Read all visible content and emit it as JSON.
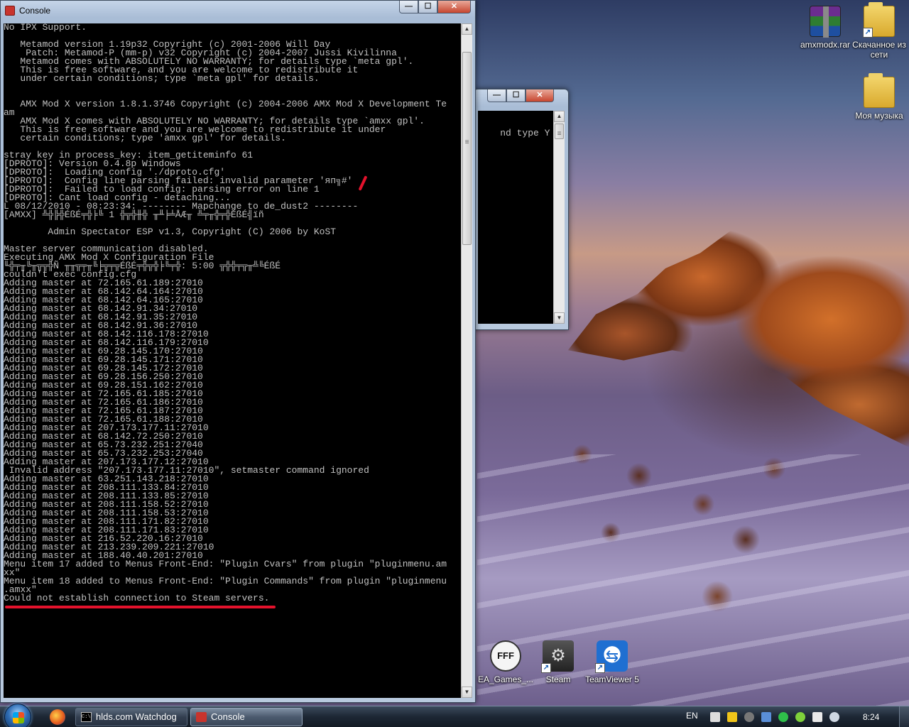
{
  "desktop": {
    "icons": [
      {
        "label": "amxmodx.rar",
        "icon": "winrar-archive-icon"
      },
      {
        "label": "Скачанное из сети",
        "icon": "folder-icon"
      },
      {
        "label": "Моя музыка",
        "icon": "folder-icon"
      },
      {
        "label": "EA_Games_...",
        "icon": "ea-games-icon"
      },
      {
        "label": "Steam",
        "icon": "steam-icon"
      },
      {
        "label": "TeamViewer 5",
        "icon": "teamviewer-icon"
      }
    ]
  },
  "console_window": {
    "title": "Console",
    "lines": [
      "No IPX Support.",
      "",
      "   Metamod version 1.19p32 Copyright (c) 2001-2006 Will Day",
      "    Patch: Metamod-P (mm-p) v32 Copyright (c) 2004-2007 Jussi Kivilinna",
      "   Metamod comes with ABSOLUTELY NO WARRANTY; for details type `meta gpl'.",
      "   This is free software, and you are welcome to redistribute it",
      "   under certain conditions; type `meta gpl' for details.",
      "",
      "",
      "   AMX Mod X version 1.8.1.3746 Copyright (c) 2004-2006 AMX Mod X Development Te",
      "am",
      "   AMX Mod X comes with ABSOLUTELY NO WARRANTY; for details type `amxx gpl'.",
      "   This is free software and you are welcome to redistribute it under",
      "   certain conditions; type 'amxx gpl' for details.",
      "",
      "stray key in process_key: item_getiteminfo 61",
      "[DPROTO]: Version 0.4.8p Windows",
      "[DPROTO]:  Loading config './dproto.cfg'",
      "[DPROTO]:  Config line parsing failed: invalid parameter 'яп╗#'",
      "[DPROTO]:  Failed to load config: parsing error on line 1",
      "[DPROTO]: Cant load config - detaching...",
      "L 08/12/2010 - 08:23:34: -------- Mapchange to de_dust2 --------",
      "[AMXX] ╩╬╠╬ÉßÉ╤╬╞╚ 1 ╬╦╬╫╬ ╥╨╞╧ÅÆ╥ ╩╤╥╬╤╬ÉßÉ╣ïñ",
      "",
      "        Admin Spectator ESP v1.3, Copyright (C) 2006 by KoST",
      "",
      "Master server communication disabled.",
      "Executing AMX Mod X Configuration File",
      "╙╬╤╥╚╥╦╦╬Ñ ╥╥╦╤╥╚╞╦╤╦ÉßÉ╤╬╦╬╞╚╤╬: 5:00 ╦╬╬╤╦╥╩╚ÉßÉ",
      "couldn't exec config.cfg",
      "Adding master at 72.165.61.189:27010",
      "Adding master at 68.142.64.164:27010",
      "Adding master at 68.142.64.165:27010",
      "Adding master at 68.142.91.34:27010",
      "Adding master at 68.142.91.35:27010",
      "Adding master at 68.142.91.36:27010",
      "Adding master at 68.142.116.178:27010",
      "Adding master at 68.142.116.179:27010",
      "Adding master at 69.28.145.170:27010",
      "Adding master at 69.28.145.171:27010",
      "Adding master at 69.28.145.172:27010",
      "Adding master at 69.28.156.250:27010",
      "Adding master at 69.28.151.162:27010",
      "Adding master at 72.165.61.185:27010",
      "Adding master at 72.165.61.186:27010",
      "Adding master at 72.165.61.187:27010",
      "Adding master at 72.165.61.188:27010",
      "Adding master at 207.173.177.11:27010",
      "Adding master at 68.142.72.250:27010",
      "Adding master at 65.73.232.251:27040",
      "Adding master at 65.73.232.253:27040",
      "Adding master at 207.173.177.12:27010",
      " Invalid address \"207.173.177.11:27010\", setmaster command ignored",
      "Adding master at 63.251.143.218:27010",
      "Adding master at 208.111.133.84:27010",
      "Adding master at 208.111.133.85:27010",
      "Adding master at 208.111.158.52:27010",
      "Adding master at 208.111.158.53:27010",
      "Adding master at 208.111.171.82:27010",
      "Adding master at 208.111.171.83:27010",
      "Adding master at 216.52.220.16:27010",
      "Adding master at 213.239.209.221:27010",
      "Adding master at 188.40.40.201:27010",
      "Menu item 17 added to Menus Front-End: \"Plugin Cvars\" from plugin \"pluginmenu.am",
      "xx\"",
      "Menu item 18 added to Menus Front-End: \"Plugin Commands\" from plugin \"pluginmenu",
      ".amxx\"",
      "Could not establish connection to Steam servers."
    ]
  },
  "watchdog_window": {
    "visible_text": "nd type Y dep"
  },
  "taskbar": {
    "buttons": [
      {
        "label": "hlds.com Watchdog",
        "icon": "cmd-icon"
      },
      {
        "label": "Console",
        "icon": "halflife-icon"
      }
    ],
    "language": "EN",
    "clock": "8:24"
  },
  "colors": {
    "console_bg": "#000000",
    "console_text": "#c0c0c0",
    "annotation_red": "#e3122c"
  }
}
